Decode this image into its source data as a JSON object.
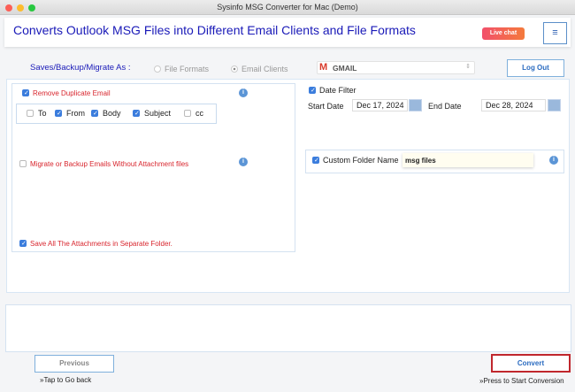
{
  "window": {
    "title": "Sysinfo MSG Converter for Mac (Demo)"
  },
  "header": {
    "title": "Converts Outlook MSG Files into Different Email Clients and File Formats",
    "live_chat": "Live chat",
    "menu_icon": "≡"
  },
  "save_as": {
    "label": "Saves/Backup/Migrate As :",
    "options": [
      "File Formats",
      "Email Clients"
    ],
    "selected": "Email Clients",
    "client": "GMAIL",
    "logout": "Log Out"
  },
  "left": {
    "remove_duplicate": {
      "label": "Remove Duplicate Email",
      "checked": true,
      "fields": [
        {
          "label": "To",
          "checked": false
        },
        {
          "label": "From",
          "checked": true
        },
        {
          "label": "Body",
          "checked": true
        },
        {
          "label": "Subject",
          "checked": true
        },
        {
          "label": "cc",
          "checked": false
        }
      ]
    },
    "without_attachment": {
      "label": "Migrate or Backup Emails Without Attachment files",
      "checked": false
    },
    "save_attachments": {
      "label": "Save All The Attachments in Separate Folder.",
      "checked": true
    }
  },
  "right": {
    "date_filter": {
      "label": "Date Filter",
      "checked": true,
      "start_label": "Start Date",
      "start": "Dec 17, 2024",
      "end_label": "End Date",
      "end": "Dec 28, 2024"
    },
    "custom_folder": {
      "label": "Custom Folder Name",
      "checked": true,
      "value": "msg files"
    }
  },
  "footer": {
    "previous": "Previous",
    "previous_hint": "»Tap to Go back",
    "convert": "Convert",
    "convert_hint": "»Press to Start Conversion"
  },
  "colors": {
    "title": "#1a1ab8",
    "accent": "#3b7ddd",
    "warning": "#d8262e",
    "convert_border": "#c0272d"
  }
}
